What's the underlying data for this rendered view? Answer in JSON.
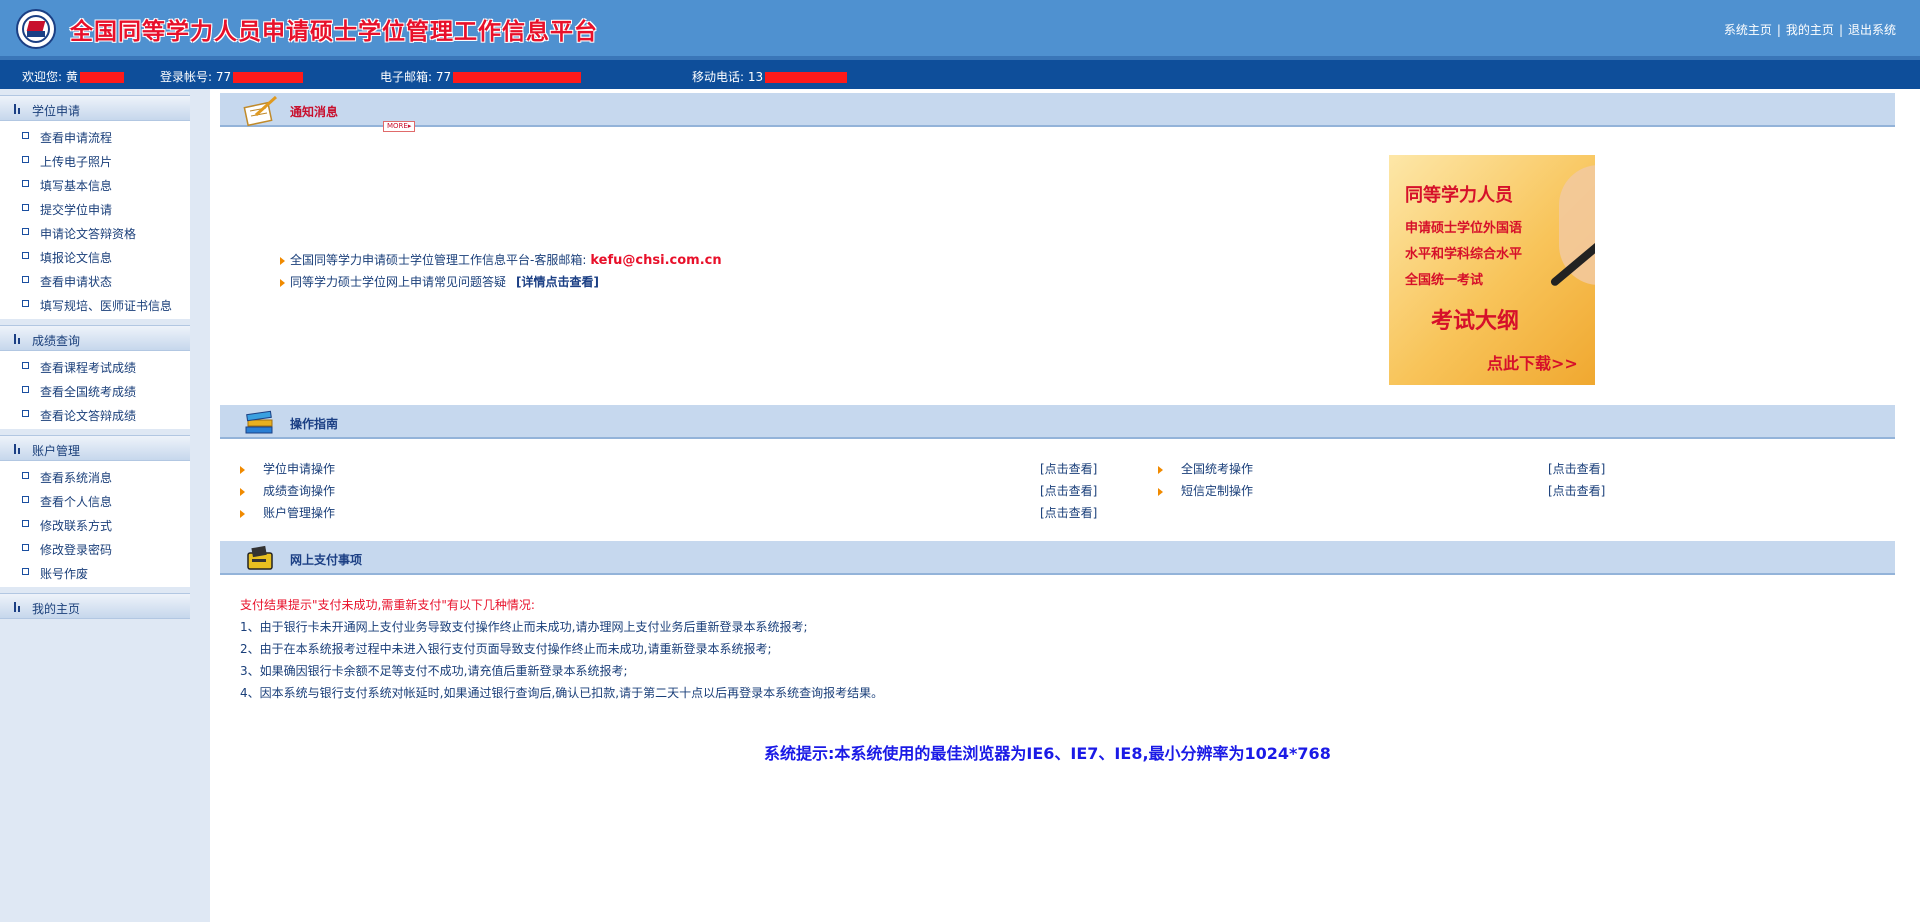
{
  "header": {
    "title": "全国同等学力人员申请硕士学位管理工作信息平台",
    "links": [
      "系统主页",
      "我的主页",
      "退出系统"
    ],
    "separator": "|"
  },
  "userbar": {
    "welcome_label": "欢迎您:",
    "welcome_value": "黄",
    "account_label": "登录帐号:",
    "account_value": "77",
    "email_label": "电子邮箱:",
    "email_value": "77",
    "phone_label": "移动电话:",
    "phone_value": "13",
    "redaction_color": "#ff1a1a"
  },
  "sidebar": {
    "sections": [
      {
        "title": "学位申请",
        "items": [
          "查看申请流程",
          "上传电子照片",
          "填写基本信息",
          "提交学位申请",
          "申请论文答辩资格",
          "填报论文信息",
          "查看申请状态",
          "填写规培、医师证书信息"
        ]
      },
      {
        "title": "成绩查询",
        "items": [
          "查看课程考试成绩",
          "查看全国统考成绩",
          "查看论文答辩成绩"
        ]
      },
      {
        "title": "账户管理",
        "items": [
          "查看系统消息",
          "查看个人信息",
          "修改联系方式",
          "修改登录密码",
          "账号作废"
        ]
      },
      {
        "title": "我的主页",
        "items": []
      }
    ]
  },
  "notices": {
    "title": "通知消息",
    "more": "MORE",
    "items": [
      {
        "text": "全国同等学力申请硕士学位管理工作信息平台-客服邮箱:",
        "email": "kefu@chsi.com.cn"
      },
      {
        "text": "同等学力硕士学位网上申请常见问题答疑",
        "link": "[详情点击查看]"
      }
    ],
    "banner": {
      "line1": "同等学力人员",
      "line2": "申请硕士学位外国语",
      "line3": "水平和学科综合水平",
      "line4": "全国统一考试",
      "big": "考试大纲",
      "download": "点此下载>>"
    }
  },
  "guide": {
    "title": "操作指南",
    "link_label": "[点击查看]",
    "items": [
      "学位申请操作",
      "全国统考操作",
      "成绩查询操作",
      "短信定制操作",
      "账户管理操作"
    ]
  },
  "payment": {
    "title": "网上支付事项",
    "intro": "支付结果提示\"支付未成功,需重新支付\"有以下几种情况:",
    "lines": [
      "1、由于银行卡未开通网上支付业务导致支付操作终止而未成功,请办理网上支付业务后重新登录本系统报考;",
      "2、由于在本系统报考过程中未进入银行支付页面导致支付操作终止而未成功,请重新登录本系统报考;",
      "3、如果确因银行卡余额不足等支付不成功,请充值后重新登录本系统报考;",
      "4、因本系统与银行支付系统对帐延时,如果通过银行查询后,确认已扣款,请于第二天十点以后再登录本系统查询报考结果。"
    ]
  },
  "system_tip": "系统提示:本系统使用的最佳浏览器为IE6、IE7、IE8,最小分辨率为1024*768"
}
